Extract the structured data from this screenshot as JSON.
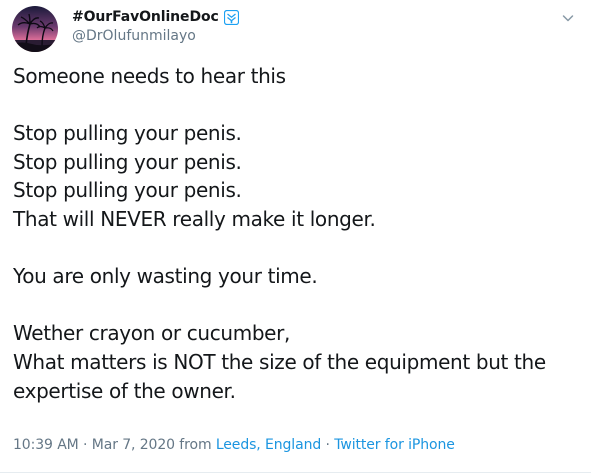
{
  "tweet": {
    "display_name": "#OurFavOnlineDoc",
    "handle": "@DrOlufunmilayo",
    "text": "Someone needs to hear this\n\nStop pulling your penis.\nStop pulling your penis.\nStop pulling your penis.\nThat will NEVER really make it longer.\n\nYou are only wasting your time.\n\nWether crayon or cucumber,\nWhat matters is NOT the size of the equipment but the expertise of the owner.",
    "time": "10:39 AM",
    "date": "Mar 7, 2020",
    "from_label": "from",
    "location": "Leeds, England",
    "separator": "·",
    "source": "Twitter for iPhone"
  },
  "icons": {
    "avatar": "palm-tree-sunset-avatar",
    "badge": "medical-badge-icon",
    "menu": "chevron-down-icon"
  },
  "colors": {
    "text": "#14171a",
    "secondary": "#657786",
    "link": "#1b95e0",
    "badge": "#1da1f2"
  }
}
